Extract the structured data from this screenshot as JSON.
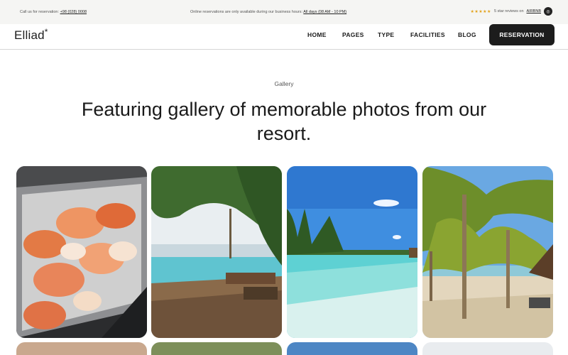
{
  "topbar": {
    "call_text": "Call us for reservation:",
    "phone": "+98 (028) 0008",
    "notice_text": "Online reservations are only available during our business hours:",
    "hours": "All days (08 AM - 10 PM)",
    "stars": "★★★★★",
    "reviews_text": "5 star reviews on",
    "reviews_site": "AIRBNB"
  },
  "header": {
    "logo": "Elliad",
    "logo_mark": "*",
    "nav": [
      "HOME",
      "PAGES",
      "TYPE",
      "FACILITIES",
      "BLOG"
    ],
    "reservation_label": "RESERVATION"
  },
  "section": {
    "eyebrow": "Gallery",
    "title": "Featuring gallery of memorable photos from our resort."
  },
  "gallery": {
    "photos": [
      {
        "subject": "crab platter"
      },
      {
        "subject": "infinity pool with wooden deck"
      },
      {
        "subject": "tropical beach with turquoise water"
      },
      {
        "subject": "palm trees on sandy beach"
      }
    ]
  },
  "colors": {
    "accent_dark": "#1c1c1c",
    "topbar_bg": "#f5f5f3",
    "star": "#e3a21a"
  }
}
